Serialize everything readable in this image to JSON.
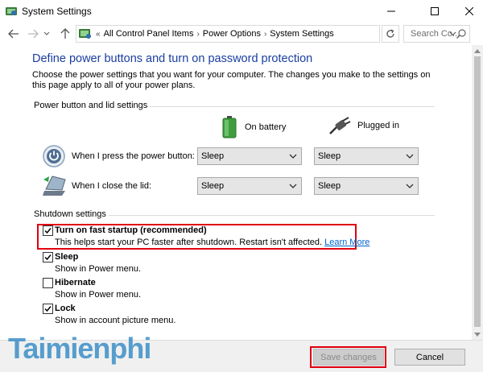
{
  "window": {
    "title": "System Settings"
  },
  "nav": {
    "breadcrumbs": [
      "All Control Panel Items",
      "Power Options",
      "System Settings"
    ],
    "overflow": "«",
    "search_placeholder": "Search Co..."
  },
  "page": {
    "heading": "Define power buttons and turn on password protection",
    "intro": "Choose the power settings that you want for your computer. The changes you make to the settings on this page apply to all of your power plans."
  },
  "power_group": {
    "label": "Power button and lid settings",
    "columns": {
      "battery": "On battery",
      "plugged": "Plugged in"
    },
    "rows": [
      {
        "label": "When I press the power button:",
        "battery": "Sleep",
        "plugged": "Sleep"
      },
      {
        "label": "When I close the lid:",
        "battery": "Sleep",
        "plugged": "Sleep"
      }
    ]
  },
  "shutdown_group": {
    "label": "Shutdown settings",
    "options": [
      {
        "title": "Turn on fast startup (recommended)",
        "desc": "This helps start your PC faster after shutdown. Restart isn't affected.",
        "link": "Learn More",
        "checked": true
      },
      {
        "title": "Sleep",
        "desc": "Show in Power menu.",
        "checked": true
      },
      {
        "title": "Hibernate",
        "desc": "Show in Power menu.",
        "checked": false
      },
      {
        "title": "Lock",
        "desc": "Show in account picture menu.",
        "checked": true
      }
    ]
  },
  "footer": {
    "save": "Save changes",
    "cancel": "Cancel"
  },
  "watermark": "Taimienphi",
  "colors": {
    "heading": "#1a3da0",
    "link": "#0066cc",
    "highlight": "#e0000f",
    "watermark": "#3c8fc7"
  },
  "icons": [
    "control-panel-icon",
    "back-arrow-icon",
    "forward-arrow-icon",
    "recent-dropdown-icon",
    "up-arrow-icon",
    "refresh-icon",
    "search-icon",
    "battery-icon",
    "plug-icon",
    "power-button-icon",
    "laptop-lid-icon",
    "checkmark-icon"
  ]
}
